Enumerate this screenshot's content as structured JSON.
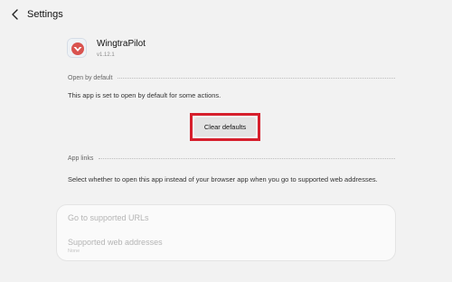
{
  "header": {
    "title": "Settings",
    "back_icon": "chevron-left-icon"
  },
  "app": {
    "name": "WingtraPilot",
    "version": "v1.12.1",
    "icon": "wingtra-app-icon"
  },
  "open_by_default": {
    "section_label": "Open by default",
    "description": "This app is set to open by default for some actions.",
    "clear_button_label": "Clear defaults",
    "highlight_color": "#d61f2c"
  },
  "app_links": {
    "section_label": "App links",
    "description": "Select whether to open this app instead of your browser app when you go to supported web addresses.",
    "items": [
      {
        "title": "Go to supported URLs",
        "subtitle": ""
      },
      {
        "title": "Supported web addresses",
        "subtitle": "None"
      }
    ]
  },
  "colors": {
    "background": "#f2f2f2",
    "card": "#fafafa",
    "disabled_text": "#b4b4b4"
  }
}
